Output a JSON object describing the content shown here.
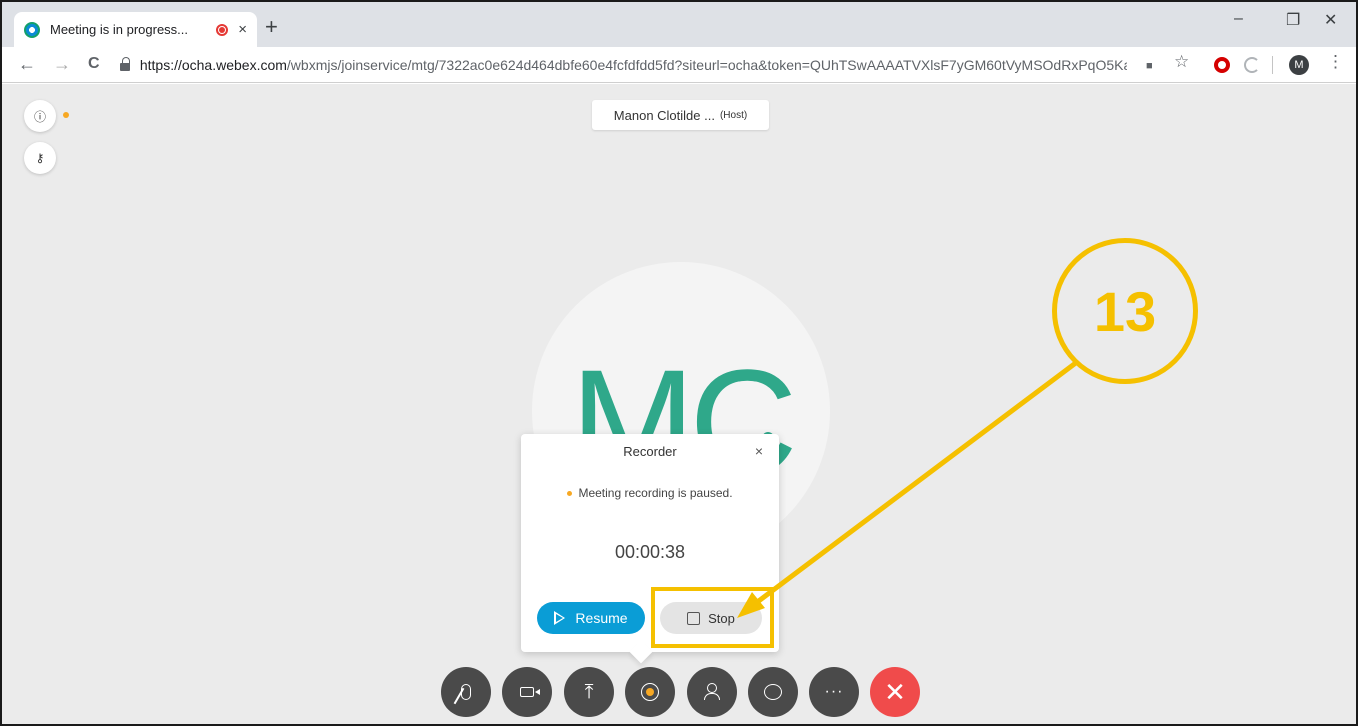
{
  "browser": {
    "tab_title": "Meeting is in progress...",
    "tab_close": "×",
    "new_tab": "+",
    "url_host": "https://ocha.webex.com",
    "url_path": "/wbxmjs/joinservice/mtg/7322ac0e624d464dbfe60e4fcfdfdd5fd?siteurl=ocha&token=QUhTSwAAAATVXlsF7yGM60tVyMSOdRxPqO5Ka...",
    "profile_initial": "M",
    "win_minimize": "–",
    "win_restore": "❐",
    "win_close": "✕",
    "back": "←",
    "forward": "→",
    "reload": "C",
    "cam_icon": "■",
    "star_icon": "☆",
    "menu_icon": "⋮"
  },
  "meeting": {
    "host_name": "Manon Clotilde ...",
    "host_tag": "(Host)",
    "avatar_initials": "MC",
    "info_icon": "ⓘ",
    "key_icon": "⚷"
  },
  "recorder": {
    "title": "Recorder",
    "close": "×",
    "status": "Meeting recording is paused.",
    "elapsed": "00:00:38",
    "resume_label": "Resume",
    "stop_label": "Stop"
  },
  "annotation": {
    "step_number": "13",
    "color": "#f5c000"
  },
  "controls": {
    "share_glyph": "⤒",
    "more_glyph": "···",
    "leave_glyph": "✕"
  },
  "colors": {
    "accent_blue": "#0a9dd6",
    "avatar_green": "#2fa88a",
    "leave_red": "#f04b4b",
    "status_orange": "#f7a823"
  }
}
